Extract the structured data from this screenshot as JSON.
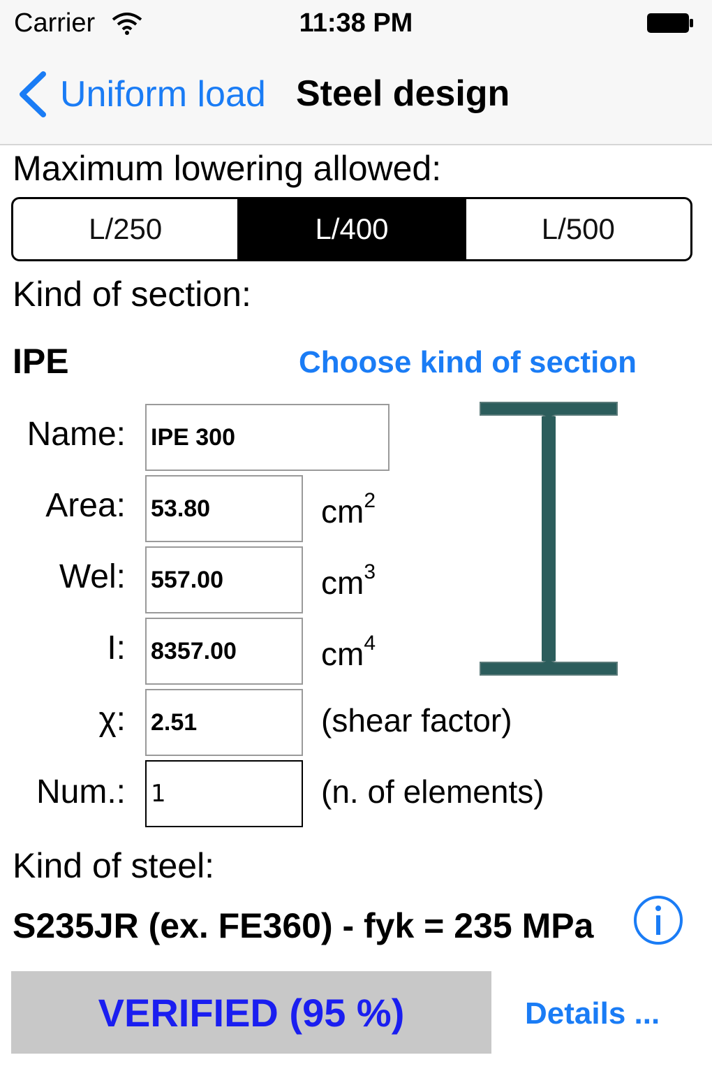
{
  "status_bar": {
    "carrier": "Carrier",
    "time": "11:38 PM"
  },
  "nav": {
    "back_label": "Uniform load",
    "title": "Steel design"
  },
  "lowering": {
    "label": "Maximum lowering allowed:",
    "options": [
      "L/250",
      "L/400",
      "L/500"
    ],
    "selected": "L/400"
  },
  "section": {
    "label": "Kind of section:",
    "type": "IPE",
    "choose_link": "Choose kind of section",
    "fields": {
      "name": {
        "label": "Name:",
        "value": "IPE 300"
      },
      "area": {
        "label": "Area:",
        "value": "53.80",
        "unit": "cm",
        "exp": "2"
      },
      "wel": {
        "label": "Wel:",
        "value": "557.00",
        "unit": "cm",
        "exp": "3"
      },
      "inertia": {
        "label": "I:",
        "value": "8357.00",
        "unit": "cm",
        "exp": "4"
      },
      "chi": {
        "label": "χ:",
        "value": "2.51",
        "note": "(shear factor)"
      },
      "num": {
        "label": "Num.:",
        "value": "1",
        "note": "(n. of elements)"
      }
    }
  },
  "steel": {
    "label": "Kind of steel:",
    "value": "S235JR (ex. FE360) - fyk = 235 MPa"
  },
  "result": {
    "status": "VERIFIED (95 %)",
    "details_link": "Details ..."
  },
  "colors": {
    "accent": "#1a7cf5",
    "verified_text": "#1a1ef0",
    "verified_bg": "#c8c8c8",
    "section_fill": "#2c5d5c"
  },
  "icons": [
    "wifi-icon",
    "battery-icon",
    "chevron-left-icon",
    "i-beam-section-icon",
    "info-icon"
  ]
}
